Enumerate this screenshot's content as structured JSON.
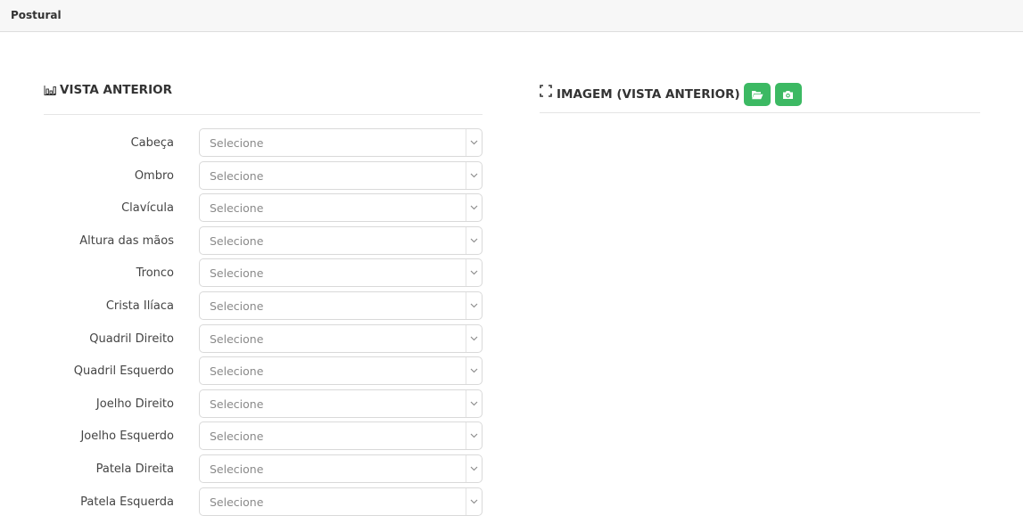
{
  "header": {
    "title": "Postural"
  },
  "left_section": {
    "title": "VISTA ANTERIOR",
    "icon": "bar-chart-icon",
    "fields": [
      {
        "label": "Cabeça",
        "value": "Selecione"
      },
      {
        "label": "Ombro",
        "value": "Selecione"
      },
      {
        "label": "Clavícula",
        "value": "Selecione"
      },
      {
        "label": "Altura das mãos",
        "value": "Selecione"
      },
      {
        "label": "Tronco",
        "value": "Selecione"
      },
      {
        "label": "Crista Ilíaca",
        "value": "Selecione"
      },
      {
        "label": "Quadril Direito",
        "value": "Selecione"
      },
      {
        "label": "Quadril Esquerdo",
        "value": "Selecione"
      },
      {
        "label": "Joelho Direito",
        "value": "Selecione"
      },
      {
        "label": "Joelho Esquerdo",
        "value": "Selecione"
      },
      {
        "label": "Patela Direita",
        "value": "Selecione"
      },
      {
        "label": "Patela Esquerda",
        "value": "Selecione"
      }
    ]
  },
  "right_section": {
    "title": "IMAGEM (VISTA ANTERIOR)",
    "icon": "expand-icon",
    "buttons": [
      {
        "name": "open-folder-button",
        "icon": "folder-open-icon"
      },
      {
        "name": "camera-button",
        "icon": "camera-icon"
      }
    ]
  },
  "colors": {
    "button_green": "#3cb963",
    "header_bg": "#f7f7f7"
  }
}
